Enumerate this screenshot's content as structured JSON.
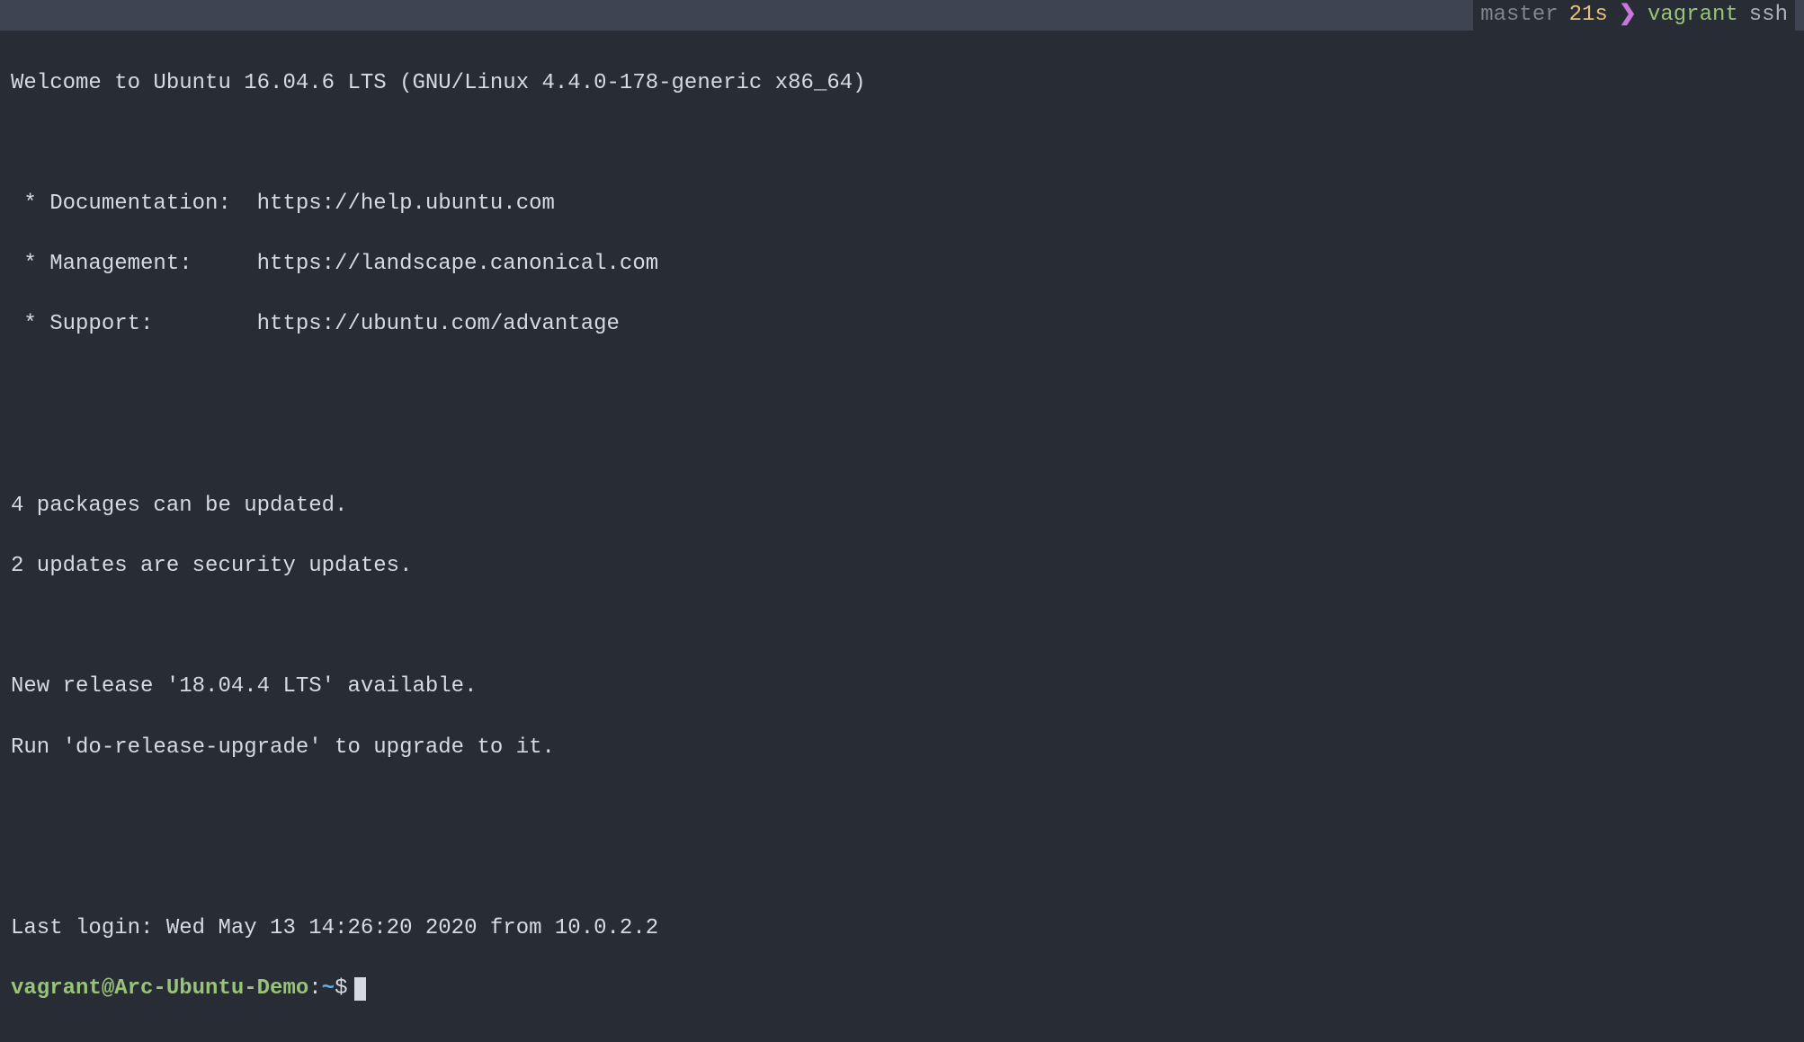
{
  "topbar": {
    "branch": "master",
    "duration": "21s",
    "chevron": "❯",
    "command": "vagrant",
    "arg": "ssh"
  },
  "motd": {
    "welcome": "Welcome to Ubuntu 16.04.6 LTS (GNU/Linux 4.4.0-178-generic x86_64)",
    "doc": " * Documentation:  https://help.ubuntu.com",
    "mgmt": " * Management:     https://landscape.canonical.com",
    "support": " * Support:        https://ubuntu.com/advantage",
    "pkg1": "4 packages can be updated.",
    "pkg2": "2 updates are security updates.",
    "rel1": "New release '18.04.4 LTS' available.",
    "rel2": "Run 'do-release-upgrade' to upgrade to it.",
    "lastlogin": "Last login: Wed May 13 14:26:20 2020 from 10.0.2.2"
  },
  "prompt": {
    "userhost": "vagrant@Arc-Ubuntu-Demo",
    "colon": ":",
    "cwd": "~",
    "dollar": "$"
  }
}
